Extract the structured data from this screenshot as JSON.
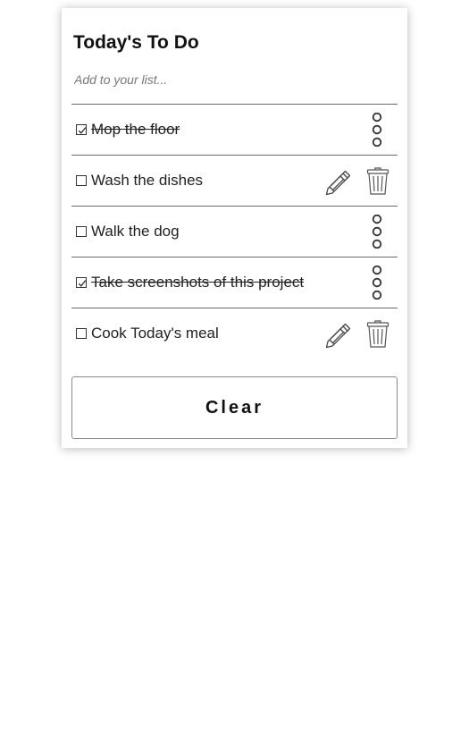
{
  "header": {
    "title": "Today's To Do"
  },
  "add_input": {
    "placeholder": "Add to your list...",
    "value": ""
  },
  "todos": [
    {
      "text": "Mop the floor",
      "checked": true,
      "actions": "menu"
    },
    {
      "text": "Wash the dishes",
      "checked": false,
      "actions": "edit-delete"
    },
    {
      "text": "Walk the dog",
      "checked": false,
      "actions": "menu"
    },
    {
      "text": "Take screenshots of this project",
      "checked": true,
      "actions": "menu"
    },
    {
      "text": "Cook Today's meal",
      "checked": false,
      "actions": "edit-delete"
    }
  ],
  "footer": {
    "clear_label": "Clear"
  },
  "icons": {
    "checkbox": "checkbox-icon",
    "menu": "three-dots-vertical-icon",
    "edit": "pencil-icon",
    "delete": "trash-icon"
  },
  "colors": {
    "divider": "#6a6a6a",
    "text": "#222222",
    "placeholder": "#777777"
  }
}
